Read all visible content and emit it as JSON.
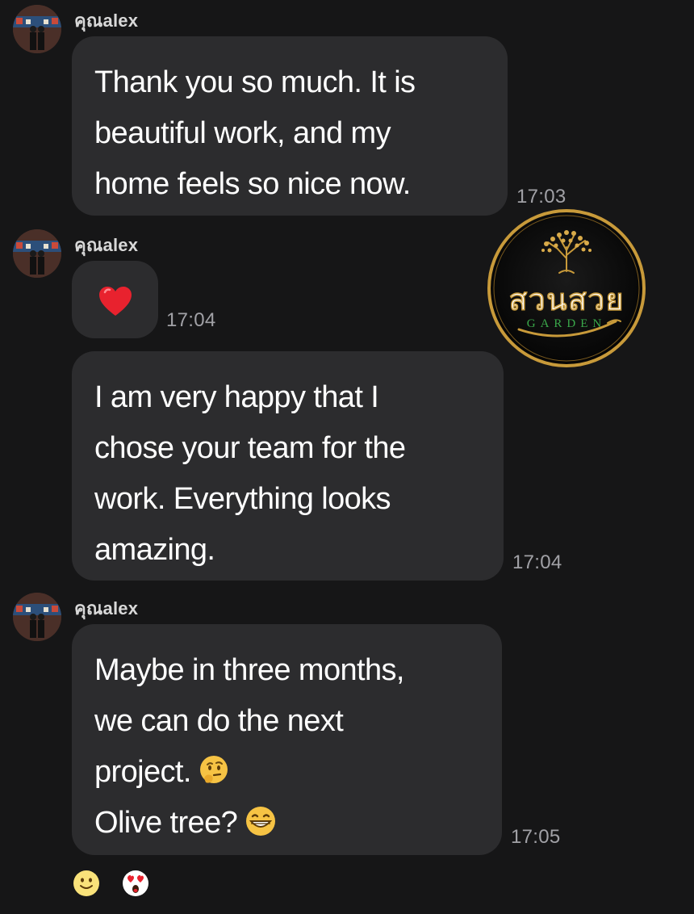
{
  "conversation": {
    "messages": [
      {
        "sender": "คุณalex",
        "lines": [
          "Thank you so much. It is",
          "beautiful work, and my",
          "home feels so nice now."
        ],
        "time": "17:03"
      },
      {
        "sender": "คุณalex",
        "emoji": "heart-icon",
        "time": "17:04"
      },
      {
        "lines": [
          "I am very happy that I",
          "chose your team for the",
          "work. Everything looks",
          "amazing."
        ],
        "time": "17:04"
      },
      {
        "sender": "คุณalex",
        "lines": [
          "Maybe in three months,",
          "we can do the next",
          "project.",
          "Olive tree?"
        ],
        "inline_emojis": [
          "thinking-face-icon",
          "grinning-face-icon"
        ],
        "time": "17:05"
      }
    ],
    "reactions": [
      "slightly-smiling-face-icon",
      "heart-eyes-face-icon"
    ]
  },
  "overlay_logo": {
    "thai_text": "สวนสวย",
    "english_text": "GARDEN"
  },
  "colors": {
    "background": "#161617",
    "bubble": "#2c2c2e",
    "timestamp": "#a1a1a6",
    "logo_gold": "#c89a3a",
    "logo_green": "#3aa84a"
  }
}
